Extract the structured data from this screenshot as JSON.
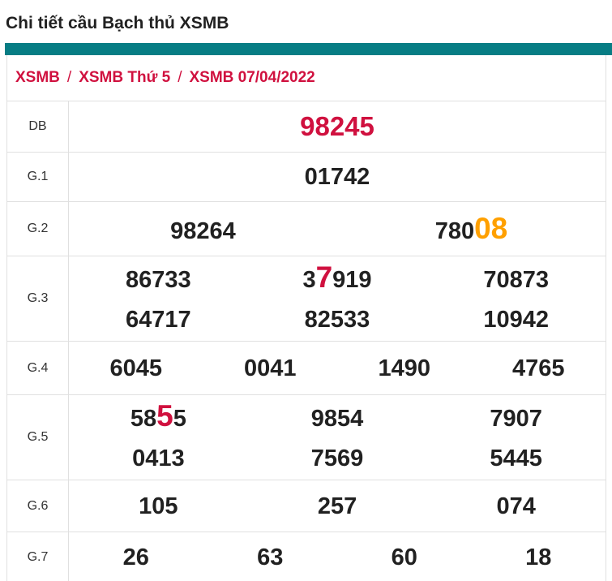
{
  "page": {
    "title": "Chi tiết cầu Bạch thủ XSMB"
  },
  "breadcrumb": {
    "separator": "/",
    "items": [
      "XSMB",
      "XSMB Thứ 5",
      "XSMB 07/04/2022"
    ]
  },
  "colors": {
    "accent_teal": "#077d84",
    "highlight_crimson": "#d0113f",
    "highlight_orange": "#ffa000",
    "text_dark": "#212121",
    "border_gray": "#e0e0e0"
  },
  "table": {
    "rows": [
      {
        "label": "DB",
        "lines": [
          [
            [
              [
                "98245",
                "db"
              ]
            ]
          ]
        ]
      },
      {
        "label": "G.1",
        "lines": [
          [
            [
              [
                "01742",
                "n"
              ]
            ]
          ]
        ]
      },
      {
        "label": "G.2",
        "lines": [
          [
            [
              [
                "98264",
                "n"
              ]
            ],
            [
              [
                "780",
                "n"
              ],
              [
                "08",
                "o"
              ]
            ]
          ]
        ]
      },
      {
        "label": "G.3",
        "lines": [
          [
            [
              [
                "86733",
                "n"
              ]
            ],
            [
              [
                "3",
                "n"
              ],
              [
                "7",
                "r"
              ],
              [
                "919",
                "n"
              ]
            ],
            [
              [
                "70873",
                "n"
              ]
            ]
          ],
          [
            [
              [
                "64717",
                "n"
              ]
            ],
            [
              [
                "82533",
                "n"
              ]
            ],
            [
              [
                "10942",
                "n"
              ]
            ]
          ]
        ]
      },
      {
        "label": "G.4",
        "lines": [
          [
            [
              [
                "6045",
                "n"
              ]
            ],
            [
              [
                "0041",
                "n"
              ]
            ],
            [
              [
                "1490",
                "n"
              ]
            ],
            [
              [
                "4765",
                "n"
              ]
            ]
          ]
        ]
      },
      {
        "label": "G.5",
        "lines": [
          [
            [
              [
                "58",
                "n"
              ],
              [
                "5",
                "r"
              ],
              [
                "5",
                "n"
              ]
            ],
            [
              [
                "9854",
                "n"
              ]
            ],
            [
              [
                "7907",
                "n"
              ]
            ]
          ],
          [
            [
              [
                "0413",
                "n"
              ]
            ],
            [
              [
                "7569",
                "n"
              ]
            ],
            [
              [
                "5445",
                "n"
              ]
            ]
          ]
        ]
      },
      {
        "label": "G.6",
        "lines": [
          [
            [
              [
                "105",
                "n"
              ]
            ],
            [
              [
                "257",
                "n"
              ]
            ],
            [
              [
                "074",
                "n"
              ]
            ]
          ]
        ]
      },
      {
        "label": "G.7",
        "lines": [
          [
            [
              [
                "26",
                "n"
              ]
            ],
            [
              [
                "63",
                "n"
              ]
            ],
            [
              [
                "60",
                "n"
              ]
            ],
            [
              [
                "18",
                "n"
              ]
            ]
          ]
        ]
      }
    ]
  }
}
